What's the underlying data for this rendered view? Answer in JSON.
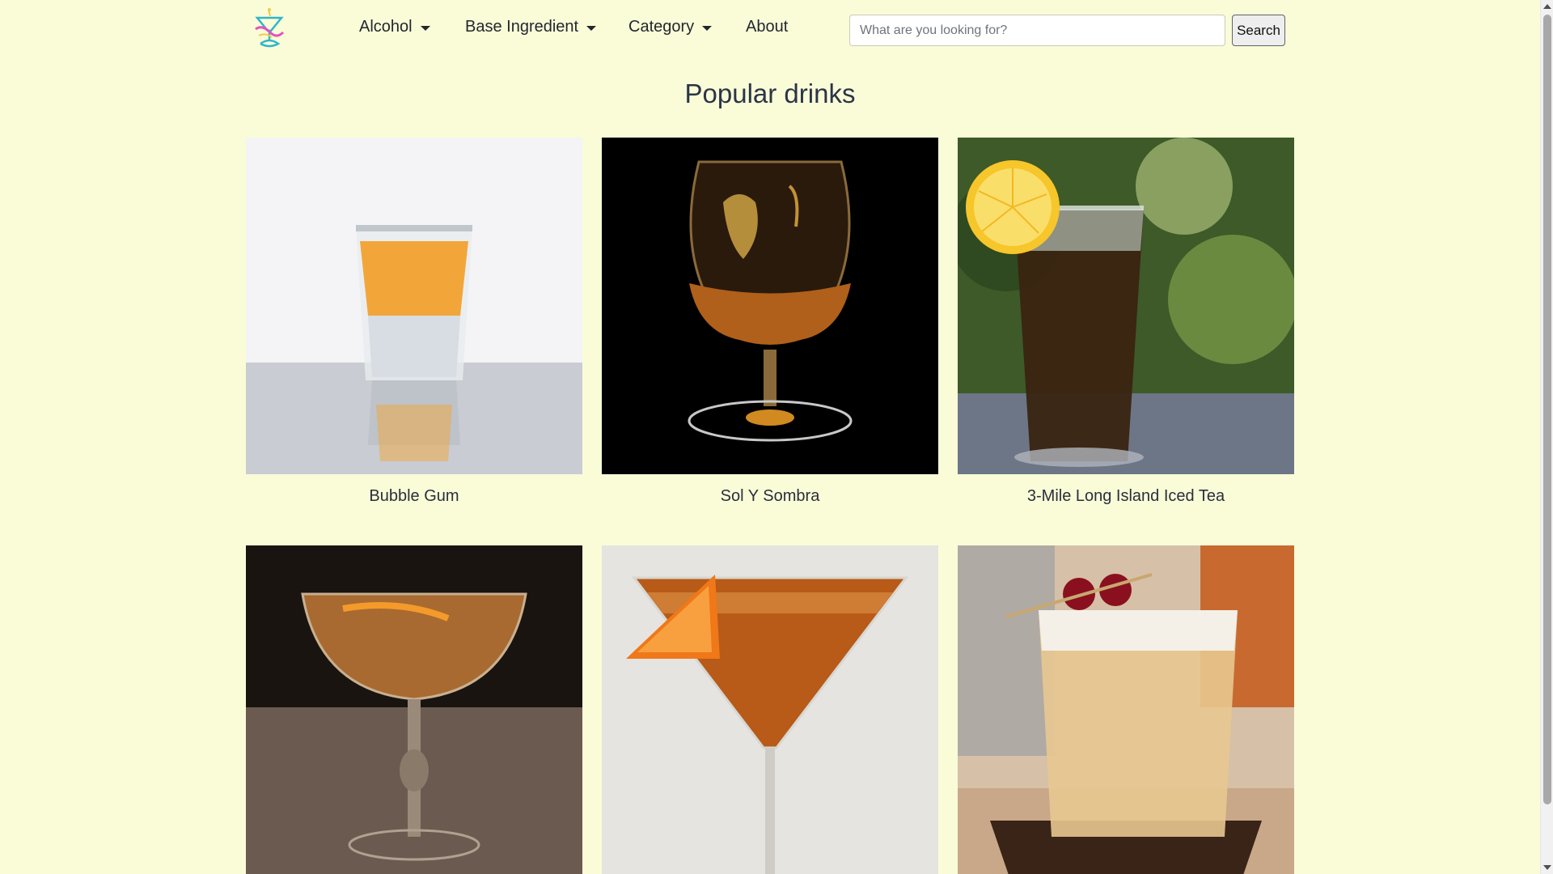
{
  "nav": {
    "logo_icon": "cocktail-glass-logo-icon",
    "items": [
      {
        "label": "Alcohol",
        "dropdown": true
      },
      {
        "label": "Base Ingredient",
        "dropdown": true
      },
      {
        "label": "Category",
        "dropdown": true
      },
      {
        "label": "About",
        "dropdown": false
      }
    ],
    "search": {
      "placeholder": "What are you looking for?",
      "value": "",
      "button_label": "Search"
    }
  },
  "main": {
    "title": "Popular drinks",
    "drinks": [
      {
        "name": "Bubble Gum",
        "image": "shot-glass-orange-drink"
      },
      {
        "name": "Sol Y Sombra",
        "image": "brandy-snifter-amber-drink"
      },
      {
        "name": "3-Mile Long Island Iced Tea",
        "image": "highball-iced-tea-lemon"
      },
      {
        "name": "",
        "image": "coupe-glass-orange-twist"
      },
      {
        "name": "",
        "image": "martini-glass-orange-slice"
      },
      {
        "name": "",
        "image": "rocks-glass-cherries"
      }
    ]
  },
  "colors": {
    "background": "#fafcd8",
    "text": "#2a2f3a",
    "title": "#2a3547"
  }
}
